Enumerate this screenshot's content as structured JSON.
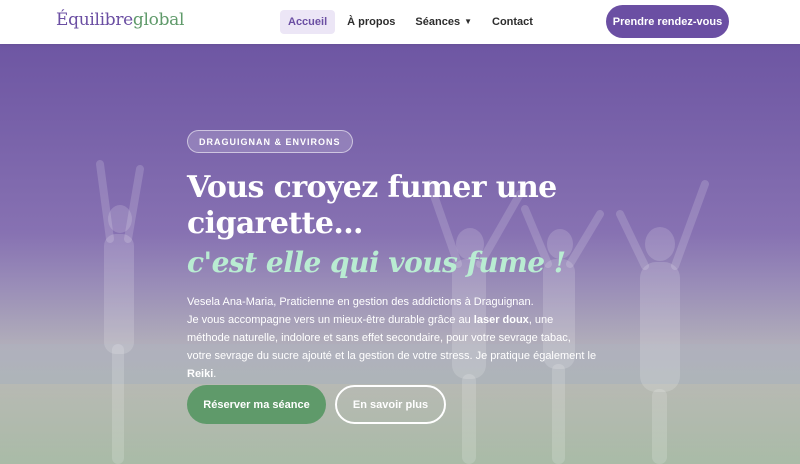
{
  "header": {
    "logo_part1": "Équilibre",
    "logo_part2": "global",
    "nav": [
      {
        "label": "Accueil"
      },
      {
        "label": "À propos"
      },
      {
        "label": "Séances"
      },
      {
        "label": "Contact"
      }
    ],
    "cta_label": "Prendre rendez-vous"
  },
  "hero": {
    "badge": "DRAGUIGNAN & ENVIRONS",
    "title_line1": "Vous croyez fumer une",
    "title_line2": "cigarette...",
    "subtitle": "c'est elle qui vous fume !",
    "para_1": "Vesela Ana-Maria, Praticienne en gestion des addictions à Draguignan.",
    "para_2a": "Je vous accompagne vers un mieux-être durable grâce au ",
    "para_2b": "laser doux",
    "para_2c": ", une méthode naturelle, indolore et sans effet secondaire, pour votre sevrage tabac, votre sevrage du sucre ajouté et la gestion de votre stress. Je pratique également le ",
    "para_2d": "Reiki",
    "para_2e": ".",
    "primary_button": "Réserver ma séance",
    "secondary_button": "En savoir plus"
  },
  "colors": {
    "brand_purple": "#6b4fa3",
    "brand_green": "#5f9a6a",
    "accent_mint": "#b9ecd2"
  }
}
